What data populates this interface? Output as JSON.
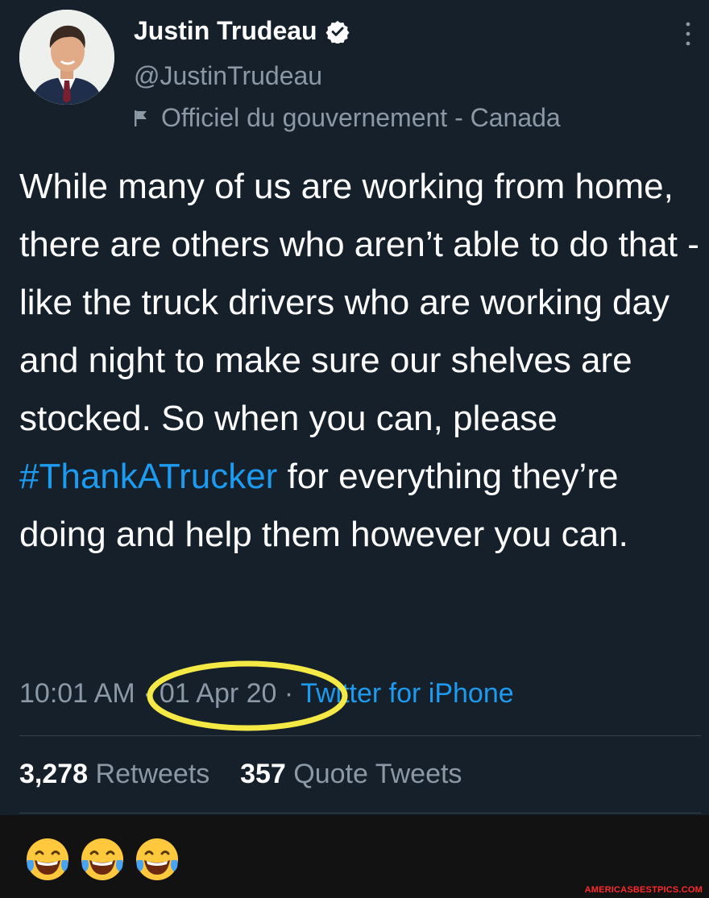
{
  "tweet": {
    "author_name": "Justin Trudeau",
    "handle": "@JustinTrudeau",
    "account_label": "Officiel du gouvernement - Canada",
    "text_before": "While many of us are working from home, there are others who aren’t able to do that - like the truck drivers who are working day and night to make sure our shelves are stocked. So when you can, please ",
    "hashtag": "#ThankATrucker",
    "text_after": " for everything they’re doing and help them however you can.",
    "time": "10:01 AM",
    "date": "01 Apr 20",
    "separator": "·",
    "source": "Twitter for iPhone",
    "retweets_count": "3,278",
    "retweets_label": "Retweets",
    "quotes_count": "357",
    "quotes_label": "Quote Tweets"
  },
  "reaction": {
    "emojis": [
      "laughing-tears-icon",
      "laughing-tears-icon",
      "laughing-tears-icon"
    ]
  },
  "watermark": "AMERICASBESTPICS.COM",
  "colors": {
    "background": "#15202b",
    "link": "#1d9bf0",
    "secondary_text": "#8b98a5",
    "highlight_circle": "#f5ea45"
  }
}
